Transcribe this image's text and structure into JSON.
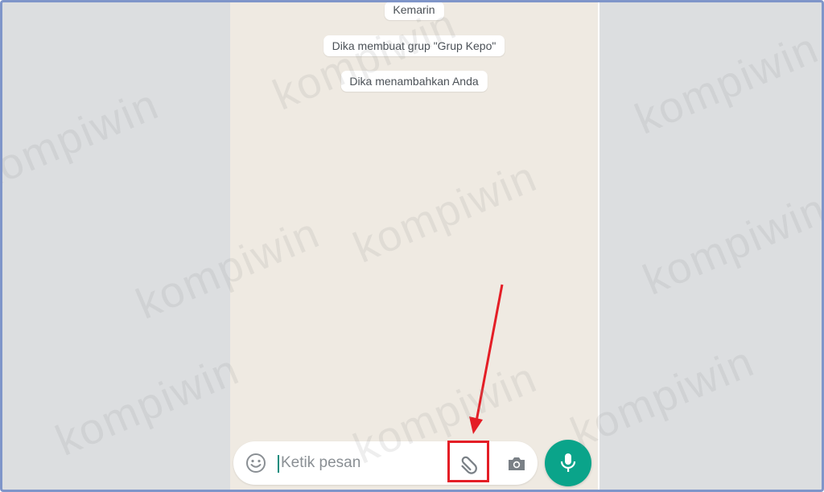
{
  "chat": {
    "date_label": "Kemarin",
    "system_messages": [
      "Dika membuat grup \"Grup Kepo\"",
      "Dika menambahkan Anda"
    ]
  },
  "composer": {
    "placeholder": "Ketik pesan",
    "icons": {
      "emoji": "emoji-icon",
      "attach": "paperclip-icon",
      "camera": "camera-icon",
      "mic": "microphone-icon"
    }
  },
  "watermark": "kompiwin",
  "colors": {
    "chat_background": "#efeae2",
    "outer_background": "#dcdee0",
    "mic_button": "#0aa48a",
    "annotation": "#e41e26",
    "frame_border": "#7f95c9"
  }
}
